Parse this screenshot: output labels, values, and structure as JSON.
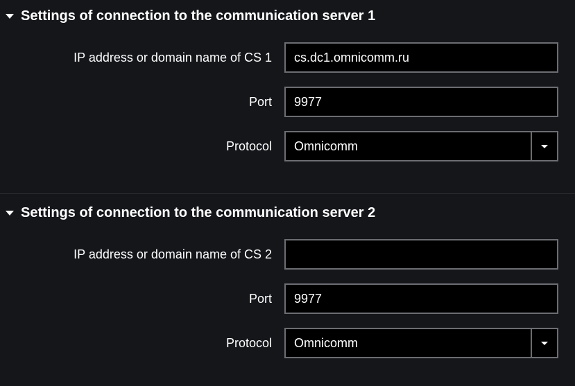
{
  "server1": {
    "title": "Settings of connection to the communication server 1",
    "ip_label": "IP address or domain name of CS 1",
    "ip_value": "cs.dc1.omnicomm.ru",
    "port_label": "Port",
    "port_value": "9977",
    "protocol_label": "Protocol",
    "protocol_value": "Omnicomm"
  },
  "server2": {
    "title": "Settings of connection to the communication server 2",
    "ip_label": "IP address or domain name of CS 2",
    "ip_value": "",
    "port_label": "Port",
    "port_value": "9977",
    "protocol_label": "Protocol",
    "protocol_value": "Omnicomm"
  }
}
